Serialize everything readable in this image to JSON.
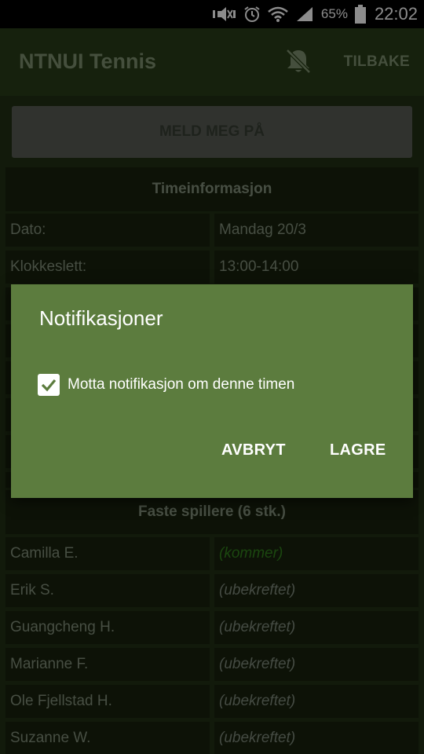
{
  "status_bar": {
    "battery_pct": "65%",
    "time": "22:02",
    "icons": [
      "mute-vibrate-icon",
      "alarm-icon",
      "wifi-icon",
      "signal-icon",
      "battery-icon"
    ]
  },
  "app_bar": {
    "title": "NTNUI Tennis",
    "notification_icon": "bell-off-icon",
    "back_label": "TILBAKE"
  },
  "signup_button": {
    "label": "MELD MEG PÅ",
    "enabled": false
  },
  "time_info": {
    "header": "Timeinformasjon",
    "rows": [
      {
        "label": "Dato:",
        "value": "Mandag 20/3"
      },
      {
        "label": "Klokkeslett:",
        "value": "13:00-14:00"
      }
    ]
  },
  "players": {
    "header": "Faste spillere (6 stk.)",
    "rows": [
      {
        "name": "Camilla E.",
        "status": "(kommer)"
      },
      {
        "name": "Erik S.",
        "status": "(ubekreftet)"
      },
      {
        "name": "Guangcheng H.",
        "status": "(ubekreftet)"
      },
      {
        "name": "Marianne F.",
        "status": "(ubekreftet)"
      },
      {
        "name": "Ole Fjellstad H.",
        "status": "(ubekreftet)"
      },
      {
        "name": "Suzanne W.",
        "status": "(ubekreftet)"
      }
    ]
  },
  "dialog": {
    "title": "Notifikasjoner",
    "checkbox_label": "Motta notifikasjon om denne timen",
    "checked": true,
    "cancel_label": "AVBRYT",
    "save_label": "LAGRE"
  },
  "colors": {
    "dialog_bg": "#5c7c3e",
    "app_bar_bg": "#233314",
    "coming_status": "#2a6e18"
  }
}
